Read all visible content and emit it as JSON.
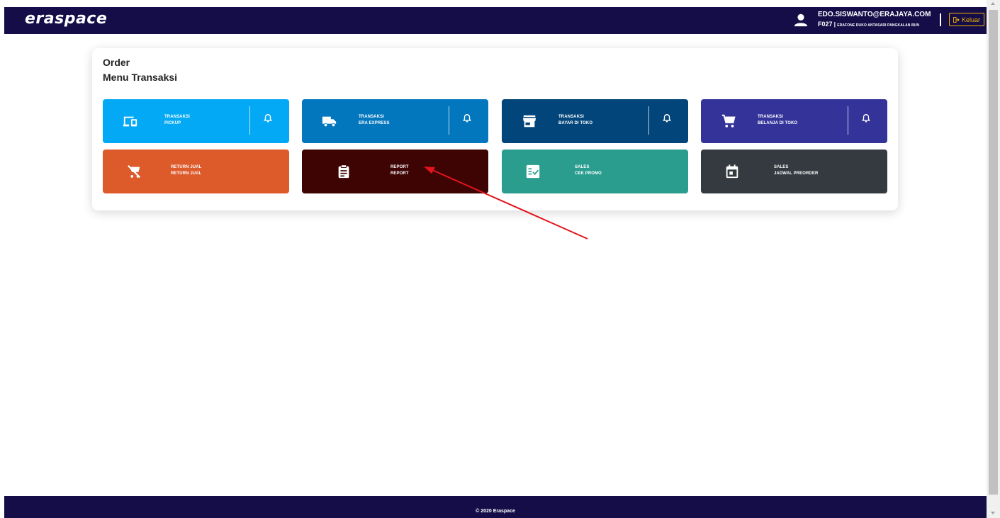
{
  "header": {
    "logo": "eraspace",
    "user_email": "EDO.SISWANTO@ERAJAYA.COM",
    "store_id": "F027",
    "store_sep": " | ",
    "store_name": "ERAFONE RUKO ANTASARI PANGKALAN BUN",
    "logout_label": "Keluar",
    "colors": {
      "bar": "#140d48",
      "logout": "#f3b400"
    }
  },
  "main": {
    "title": "Order",
    "subtitle": "Menu Transaksi",
    "tiles": [
      {
        "line1": "TRANSAKSI",
        "line2": "PICKUP",
        "icon": "devices-icon",
        "bell": true,
        "color": "#03a9f4"
      },
      {
        "line1": "TRANSAKSI",
        "line2": "ERA EXPRESS",
        "icon": "truck-icon",
        "bell": true,
        "color": "#0277bd"
      },
      {
        "line1": "TRANSAKSI",
        "line2": "BAYAR DI TOKO",
        "icon": "store-icon",
        "bell": true,
        "color": "#01457a"
      },
      {
        "line1": "TRANSAKSI",
        "line2": "BELANJA DI TOKO",
        "icon": "cart-icon",
        "bell": true,
        "color": "#33339a"
      },
      {
        "line1": "RETURN JUAL",
        "line2": "RETURN JUAL",
        "icon": "remove-cart-icon",
        "bell": false,
        "color": "#dd5a2b"
      },
      {
        "line1": "REPORT",
        "line2": "REPORT",
        "icon": "clipboard-icon",
        "bell": false,
        "color": "#3e0303"
      },
      {
        "line1": "SALES",
        "line2": "CEK PROMO",
        "icon": "checklist-icon",
        "bell": false,
        "color": "#2a9d8f"
      },
      {
        "line1": "SALES",
        "line2": "JADWAL PREORDER",
        "icon": "calendar-icon",
        "bell": false,
        "color": "#343a40"
      }
    ]
  },
  "footer": {
    "text": "© 2020 Eraspace"
  },
  "annotation": {
    "arrow_color": "#e3141b"
  }
}
